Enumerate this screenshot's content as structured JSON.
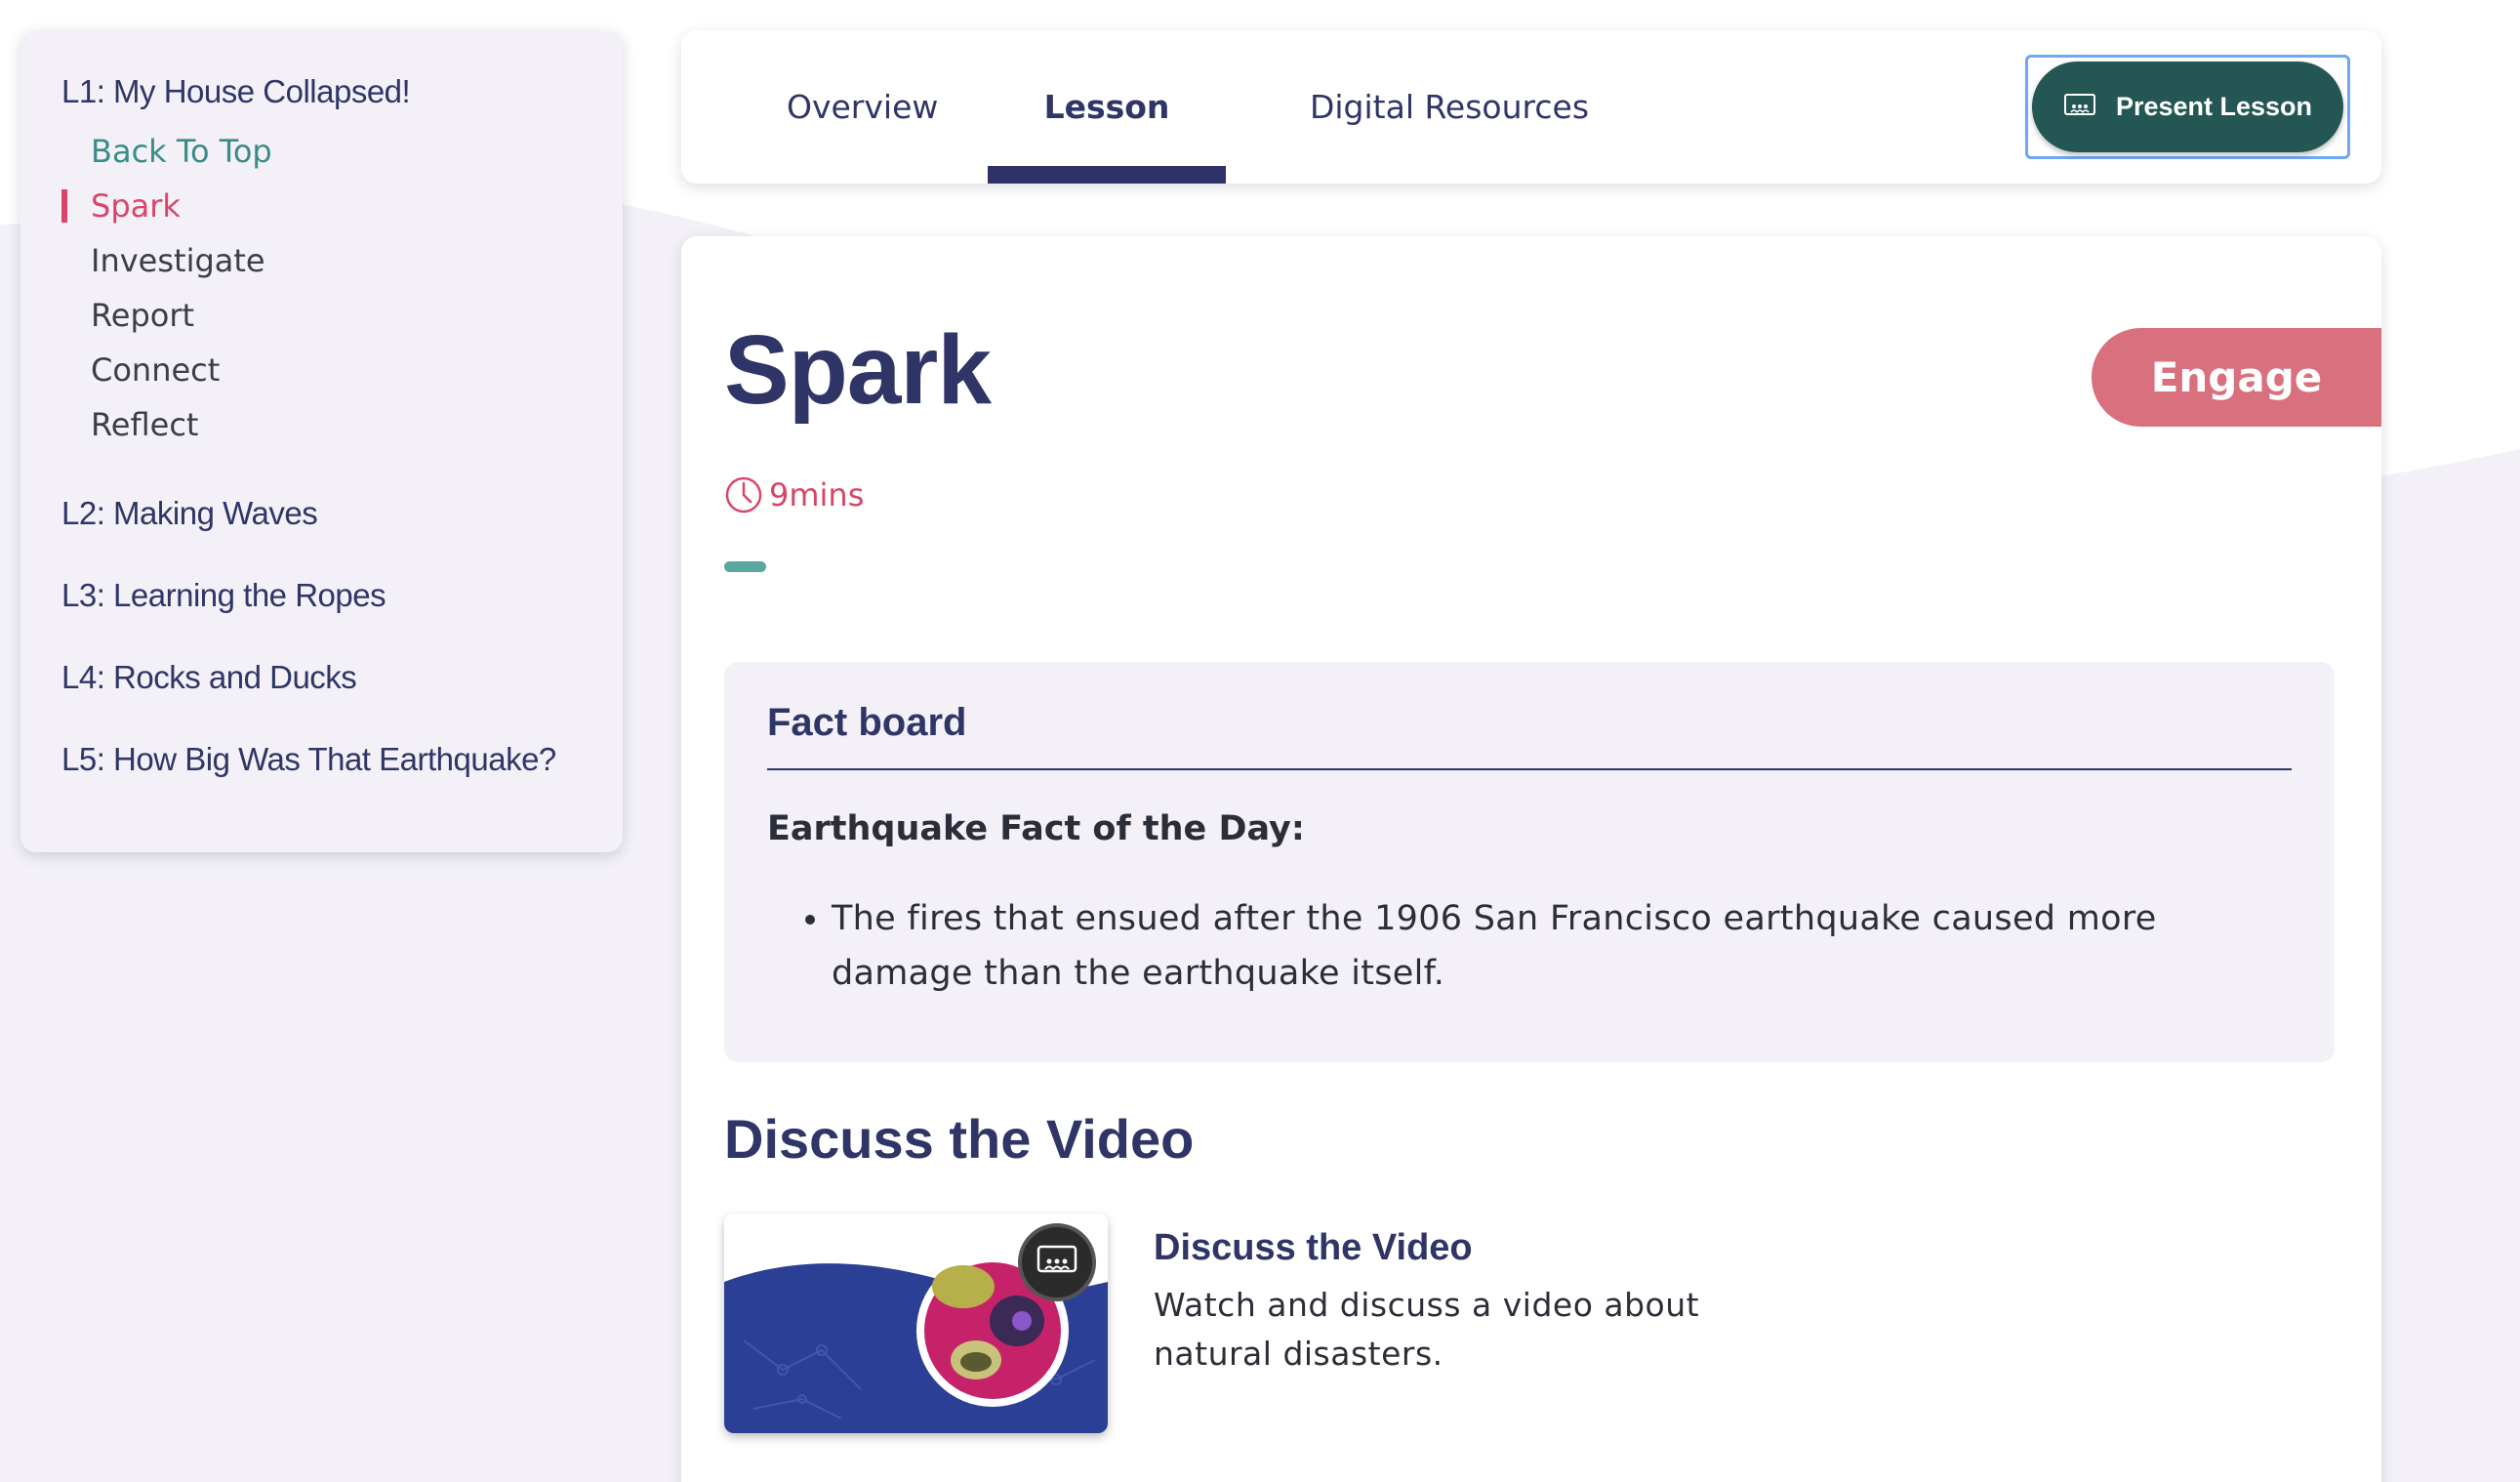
{
  "sidebar": {
    "current_lesson": "L1: My House Collapsed!",
    "sub_items": [
      {
        "label": "Back To Top"
      },
      {
        "label": "Spark"
      },
      {
        "label": "Investigate"
      },
      {
        "label": "Report"
      },
      {
        "label": "Connect"
      },
      {
        "label": "Reflect"
      }
    ],
    "active_item": "Spark",
    "lessons": [
      {
        "label": "L2: Making Waves"
      },
      {
        "label": "L3: Learning the Ropes"
      },
      {
        "label": "L4: Rocks and Ducks"
      },
      {
        "label": "L5: How Big Was That Earthquake?"
      }
    ]
  },
  "tabs": {
    "items": [
      {
        "label": "Overview"
      },
      {
        "label": "Lesson"
      },
      {
        "label": "Digital Resources"
      }
    ],
    "active": "Lesson",
    "present_button": "Present Lesson"
  },
  "main": {
    "title": "Spark",
    "badge": "Engage",
    "duration": "9mins",
    "factboard": {
      "title": "Fact board",
      "subtitle": "Earthquake Fact of the Day:",
      "bullets": [
        "The fires that ensued after the 1906 San Francisco earthquake caused more damage than the earthquake itself."
      ]
    },
    "section_heading": "Discuss the Video",
    "video": {
      "title": "Discuss the Video",
      "description": "Watch and discuss a video about natural disasters."
    }
  },
  "colors": {
    "navy": "#2f3566",
    "accent_pink": "#d9456a",
    "teal_link": "#3a8c88",
    "present_button_bg": "#245754",
    "engage_badge": "#d8707d",
    "tab_underline": "#2d3168"
  },
  "icons": [
    "present-screen-icon",
    "clock-icon",
    "bullet-dot"
  ]
}
